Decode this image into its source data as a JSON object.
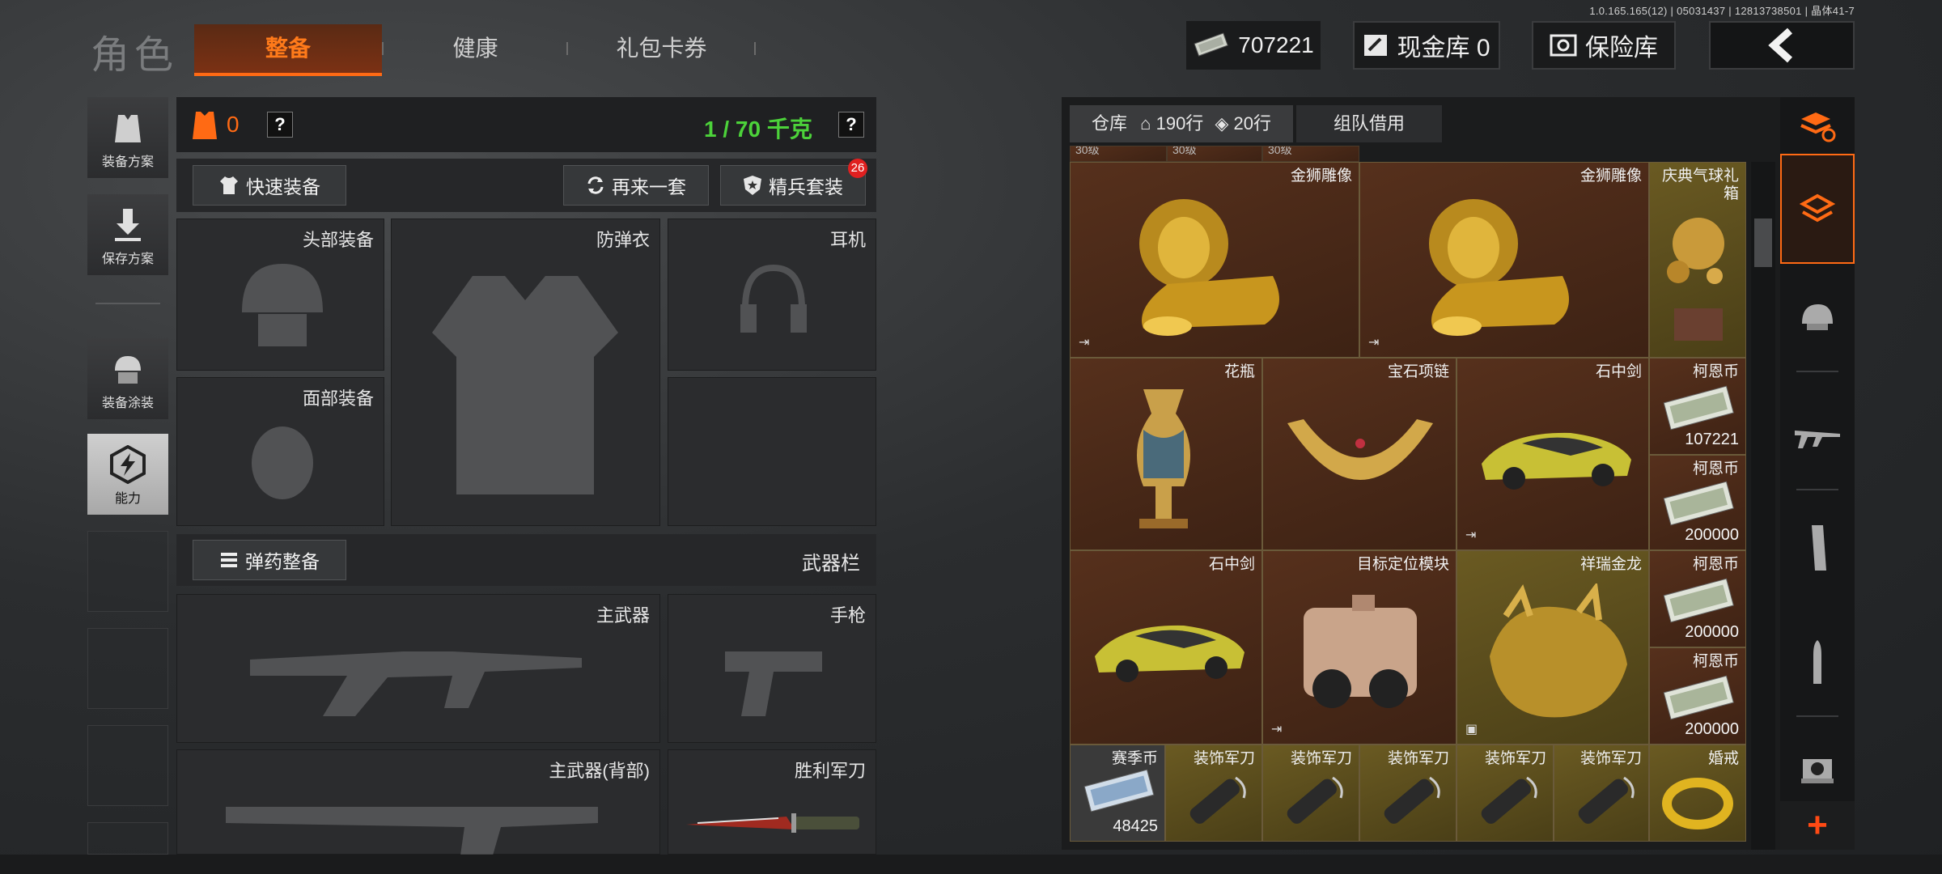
{
  "build_info": "1.0.165.165(12) | 05031437 | 12813738501 | 晶体41-7",
  "header": {
    "title": "角色",
    "tabs": [
      {
        "label": "整备",
        "active": true
      },
      {
        "label": "健康",
        "active": false
      },
      {
        "label": "礼包卡券",
        "active": false
      }
    ],
    "money": "707221",
    "cash_vault": "现金库 0",
    "safe": "保险库"
  },
  "left_menu": [
    {
      "label": "装备方案",
      "icon": "vest-icon"
    },
    {
      "label": "保存方案",
      "icon": "download-icon"
    },
    {
      "label": "装备涂装",
      "icon": "helmet-skin-icon"
    },
    {
      "label": "能力",
      "icon": "bolt-icon"
    }
  ],
  "gear": {
    "armor_count": "0",
    "weight": "1 / 70 千克",
    "help": "?",
    "quick_equip": "快速装备",
    "again": "再来一套",
    "elite": "精兵套装",
    "elite_badge": "26",
    "slots": {
      "head": "头部装备",
      "vest": "防弹衣",
      "headset": "耳机",
      "face": "面部装备",
      "ammo": "弹药整备",
      "weapon_bar": "武器栏",
      "primary": "主武器",
      "pistol": "手枪",
      "primary_back": "主武器(背部)",
      "knife": "胜利军刀"
    }
  },
  "inventory": {
    "tab_label": "仓库",
    "rows_a": "190行",
    "rows_b": "20行",
    "team_borrow": "组队借用",
    "cells": {
      "lion1": "金狮雕像",
      "lion2": "金狮雕像",
      "balloon": "庆典气球礼箱",
      "vase": "花瓶",
      "necklace": "宝石项链",
      "sword_car1": "石中剑",
      "coin1_name": "柯恩币",
      "coin1_val": "107221",
      "coin2_name": "柯恩币",
      "coin2_val": "200000",
      "sword_car2": "石中剑",
      "target": "目标定位模块",
      "dragon": "祥瑞金龙",
      "coin3_name": "柯恩币",
      "coin3_val": "200000",
      "coin4_name": "柯恩币",
      "coin4_val": "200000",
      "season_name": "赛季币",
      "season_val": "48425",
      "knife1": "装饰军刀",
      "knife2": "装饰军刀",
      "knife3": "装饰军刀",
      "knife4": "装饰军刀",
      "knife5": "装饰军刀",
      "ring": "婚戒",
      "top_partial_1": "30级",
      "top_partial_2": "30级",
      "top_partial_3": "30级"
    }
  },
  "right_rail": {
    "add": "+"
  },
  "colors": {
    "accent": "#ff6a14",
    "weight_green": "#4cd23a",
    "brown_cell": "#4a2a18",
    "olive_cell": "#5a4d1e"
  }
}
